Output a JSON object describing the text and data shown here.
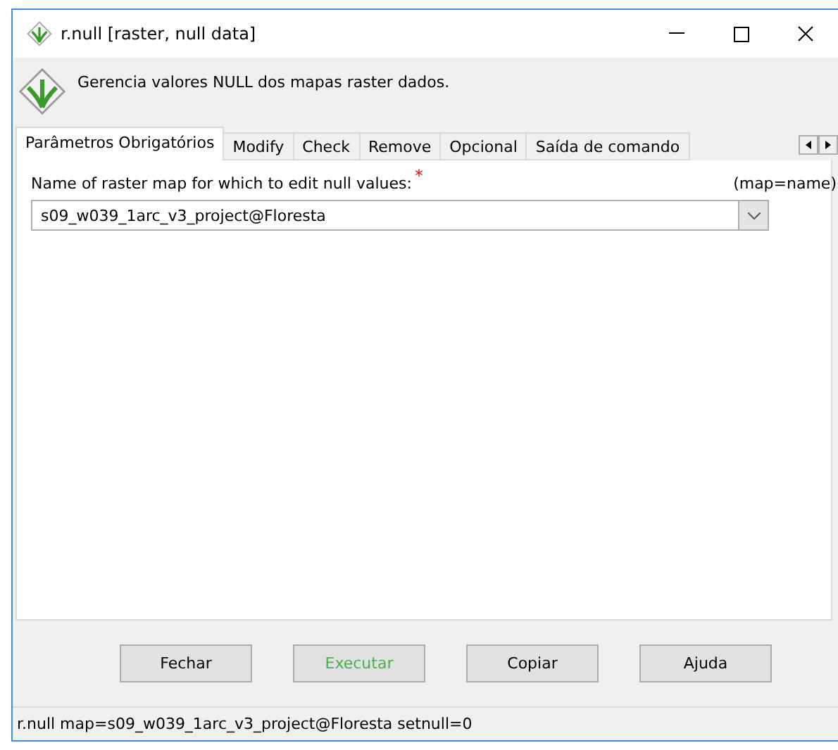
{
  "window": {
    "title": "r.null [raster, null data]"
  },
  "description": "Gerencia valores NULL dos mapas raster dados.",
  "tabs": [
    {
      "label": "Parâmetros Obrigatórios",
      "selected": true
    },
    {
      "label": "Modify",
      "selected": false
    },
    {
      "label": "Check",
      "selected": false
    },
    {
      "label": "Remove",
      "selected": false
    },
    {
      "label": "Opcional",
      "selected": false
    },
    {
      "label": "Saída de comando",
      "selected": false
    }
  ],
  "field": {
    "label": "Name of raster map for which to edit null values:",
    "required_mark": "*",
    "key": "(map=name)",
    "value": "s09_w039_1arc_v3_project@Floresta"
  },
  "buttons": [
    {
      "label": "Fechar",
      "kind": "normal"
    },
    {
      "label": "Executar",
      "kind": "run"
    },
    {
      "label": "Copiar",
      "kind": "normal"
    },
    {
      "label": "Ajuda",
      "kind": "normal"
    }
  ],
  "status_bar": "r.null map=s09_w039_1arc_v3_project@Floresta setnull=0"
}
